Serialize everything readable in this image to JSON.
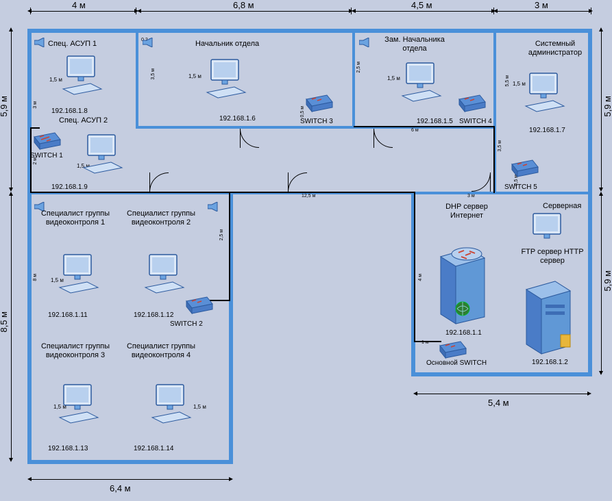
{
  "dims": {
    "top": {
      "a": "4 м",
      "b": "6,8 м",
      "c": "4,5 м",
      "d": "3 м"
    },
    "left": {
      "a": "5,9 м",
      "b": "8,5 м"
    },
    "right": {
      "a": "5,9 м",
      "b": "5,9 м"
    },
    "bottom": {
      "a": "6,4 м",
      "b": "5,4 м"
    },
    "inner": {
      "a": "3,5 м",
      "b": "0,2 м",
      "c": "2,5 м",
      "d": "5,5 м",
      "e": "3 м",
      "f": "2 м",
      "g": "8 м",
      "h": "0,5 м",
      "i": "6 м",
      "j": "3,5 м",
      "k": "0,5 м",
      "l": "3 м",
      "m": "12,5 м",
      "n": "2,5 м",
      "o": "4 м",
      "p": "1 м"
    }
  },
  "rooms": {
    "spec1": "Спец. АСУП 1",
    "spec2": "Спец. АСУП 2",
    "chief": "Начальник отдела",
    "deputy": "Зам. Начальника отдела",
    "sysadmin": "Системный администратор",
    "video1": "Специалист группы видеоконтроля 1",
    "video2": "Специалист группы видеоконтроля 2",
    "video3": "Специалист группы видеоконтроля 3",
    "video4": "Специалист группы видеоконтроля 4",
    "server_room": "Серверная",
    "dhcp": "DHP сервер Интернет",
    "ftp": "FTP сервер HTTP сервер"
  },
  "ips": {
    "spec1": "192.168.1.8",
    "spec2": "192.168.1.9",
    "chief": "192.168.1.6",
    "deputy": "192.168.1.5",
    "sysadmin": "192.168.1.7",
    "video1": "192.168.1.11",
    "video2": "192.168.1.12",
    "video3": "192.168.1.13",
    "video4": "192.168.1.14",
    "srv1": "192.168.1.1",
    "srv2": "192.168.1.2"
  },
  "switches": {
    "s1": "SWITCH 1",
    "s2": "SWITCH 2",
    "s3": "SWITCH 3",
    "s4": "SWITCH 4",
    "s5": "SWITCH 5",
    "main": "Основной SWITCH"
  },
  "cable_len": "1,5 м",
  "colors": {
    "wall": "#4a90d9",
    "bg": "#c5cde0",
    "device1": "#6ba3e0",
    "device2": "#3d6db5"
  }
}
